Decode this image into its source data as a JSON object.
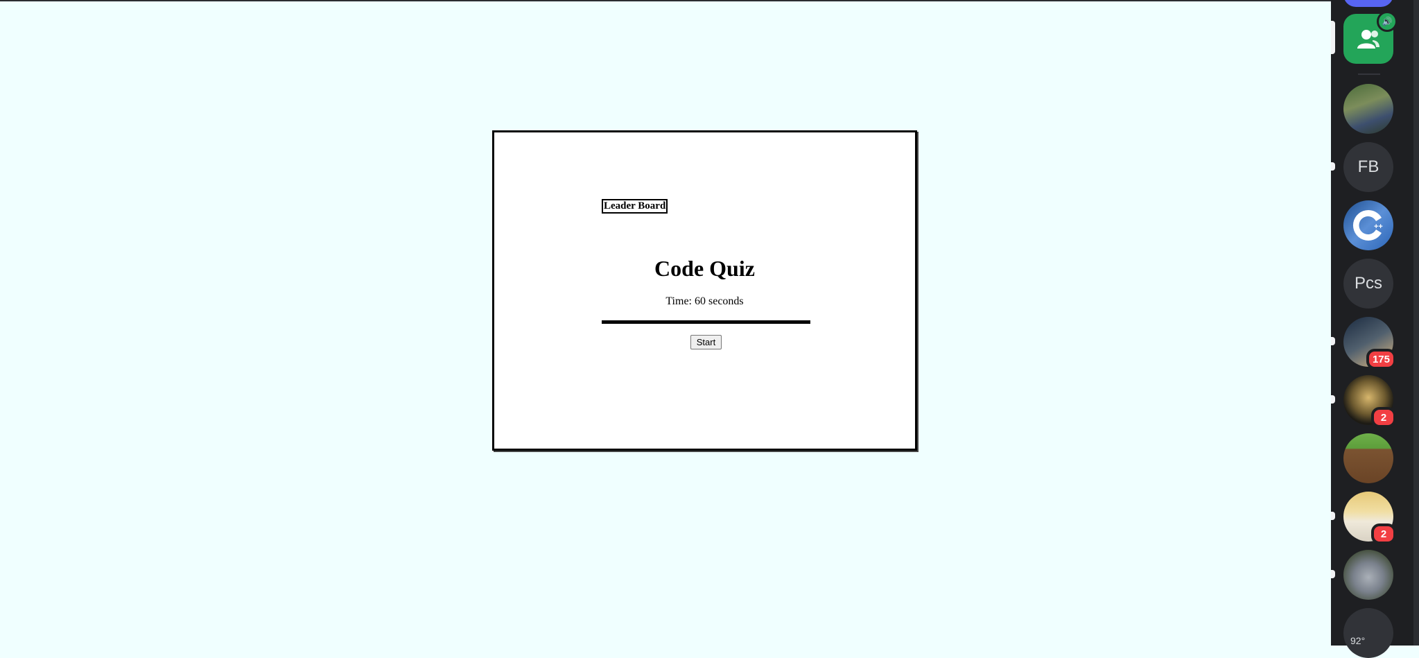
{
  "quiz": {
    "leaderboard_label": "Leader Board",
    "title": "Code Quiz",
    "timer_text": "Time: 60 seconds",
    "progress_fraction": 1.0,
    "start_label": "Start"
  },
  "sidebar": {
    "servers": [
      {
        "label": "",
        "kind": "voice-channel"
      },
      {
        "label": "",
        "kind": "image"
      },
      {
        "label": "FB"
      },
      {
        "label": "",
        "kind": "image"
      },
      {
        "label": "Pcs"
      },
      {
        "label": "",
        "kind": "image",
        "badge": "175"
      },
      {
        "label": "",
        "kind": "image",
        "badge": "2"
      },
      {
        "label": "",
        "kind": "image"
      },
      {
        "label": "",
        "kind": "image",
        "badge": "2"
      },
      {
        "label": "",
        "kind": "image"
      }
    ]
  },
  "taskbar": {
    "temperature": "92°"
  },
  "colors": {
    "page_bg": "#f0ffff",
    "rail_bg": "#1e1f22",
    "badge": "#f23f43",
    "voice": "#23a559"
  }
}
